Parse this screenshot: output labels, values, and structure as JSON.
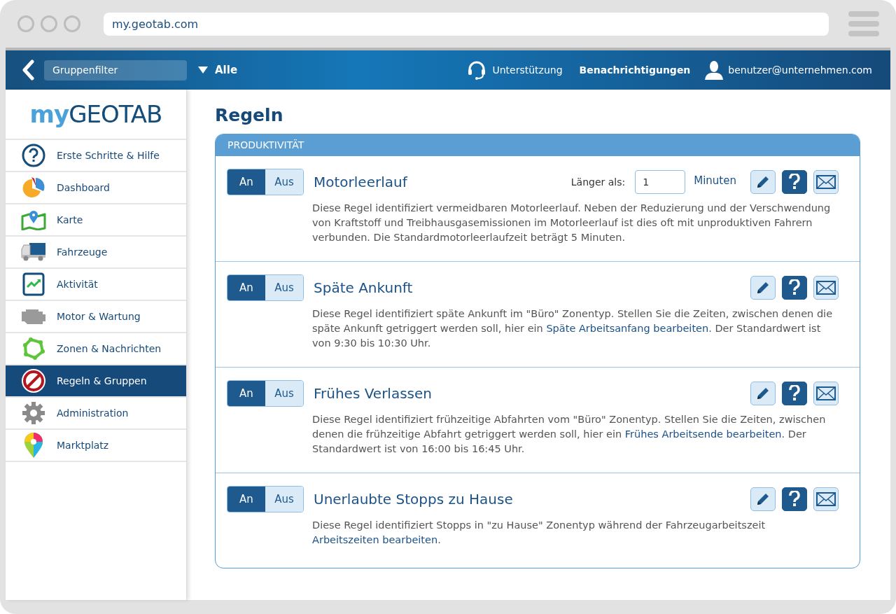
{
  "browser": {
    "url": "my.geotab.com"
  },
  "header": {
    "group_filter": {
      "placeholder": "Gruppenfilter"
    },
    "filter_value": "Alle",
    "support": "Unterstützung",
    "notifications": "Benachrichtigungen",
    "user": "benutzer@unternehmen.com"
  },
  "sidebar": {
    "logo": {
      "prefix": "my",
      "name": "GEOTAB"
    },
    "items": [
      {
        "label": "Erste Schritte & Hilfe",
        "kind": "help",
        "selected": false
      },
      {
        "label": "Dashboard",
        "kind": "pie",
        "selected": false
      },
      {
        "label": "Karte",
        "kind": "map",
        "selected": false
      },
      {
        "label": "Fahrzeuge",
        "kind": "truck",
        "selected": false
      },
      {
        "label": "Aktivität",
        "kind": "chart",
        "selected": false
      },
      {
        "label": "Motor & Wartung",
        "kind": "engine",
        "selected": false
      },
      {
        "label": "Zonen & Nachrichten",
        "kind": "zone",
        "selected": false
      },
      {
        "label": "Regeln & Gruppen",
        "kind": "forbidden",
        "selected": true
      },
      {
        "label": "Administration",
        "kind": "gear",
        "selected": false
      },
      {
        "label": "Marktplatz",
        "kind": "pin",
        "selected": false
      }
    ]
  },
  "page": {
    "title": "Regeln",
    "section": {
      "title": "PRODUKTIVITÄT",
      "rules": [
        {
          "toggle": [
            {
              "label": "An",
              "selected": true
            },
            {
              "label": "Aus",
              "selected": false
            }
          ],
          "name": "Motorleerlauf",
          "setting": {
            "label": "Länger als:",
            "value": "1",
            "unit": "Minuten"
          },
          "description": [
            {
              "text": "Diese Regel identifiziert vermeidbaren Motorleerlauf. Neben der Reduzierung und der Verschwendung von Kraftstoff und Treibhausgasemissionen im Motorleerlauf ist dies oft mit unproduktiven Fahrern verbunden. Die Standardmotorleerlaufzeit beträgt 5 Minuten."
            }
          ]
        },
        {
          "toggle": [
            {
              "label": "An",
              "selected": true
            },
            {
              "label": "Aus",
              "selected": false
            }
          ],
          "name": "Späte Ankunft",
          "description": [
            {
              "text": "Diese Regel identifiziert späte Ankunft im \"Büro\" Zonentyp. Stellen Sie die Zeiten, zwischen denen die späte Ankunft getriggert werden soll, hier ein "
            },
            {
              "link": "Späte Arbeitsanfang bearbeiten"
            },
            {
              "text": ". Der Standardwert ist von 9:30 bis 10:30 Uhr."
            }
          ]
        },
        {
          "toggle": [
            {
              "label": "An",
              "selected": true
            },
            {
              "label": "Aus",
              "selected": false
            }
          ],
          "name": "Frühes Verlassen",
          "description": [
            {
              "text": "Diese Regel identifiziert frühzeitige Abfahrten vom \"Büro\" Zonentyp. Stellen Sie die Zeiten, zwischen denen die frühzeitige Abfahrt getriggert werden soll, hier ein "
            },
            {
              "link": "Frühes Arbeitsende bearbeiten"
            },
            {
              "text": ". Der Standardwert ist von 16:00 bis 16:45 Uhr."
            }
          ]
        },
        {
          "toggle": [
            {
              "label": "An",
              "selected": true
            },
            {
              "label": "Aus",
              "selected": false
            }
          ],
          "name": "Unerlaubte Stopps zu Hause",
          "description": [
            {
              "text": "Diese Regel identifiziert Stopps in \"zu Hause\" Zonentyp während der Fahrzeugarbeitszeit "
            },
            {
              "link": "Arbeitszeiten bearbeiten"
            },
            {
              "text": "."
            }
          ]
        }
      ]
    }
  }
}
